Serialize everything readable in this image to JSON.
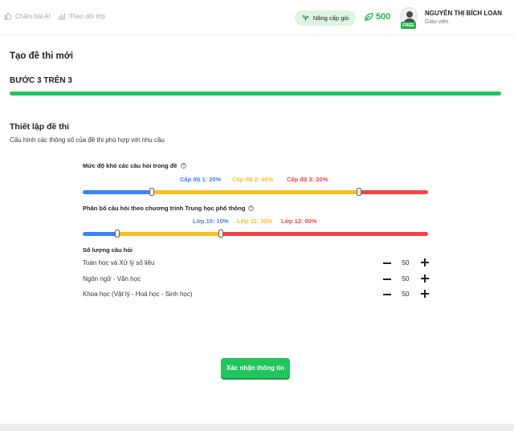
{
  "topbar": {
    "nav": [
      {
        "label": "Chấm bài AI",
        "icon": "thumbs-up-icon"
      },
      {
        "label": "Theo dõi lớp",
        "icon": "bar-chart-icon"
      }
    ],
    "upgrade_label": "Nâng cấp gói",
    "points": "500",
    "user": {
      "name": "NGUYỄN THỊ BÍCH LOAN",
      "role": "Giáo viên",
      "badge": "FREE"
    }
  },
  "page": {
    "title": "Tạo đề thi mới",
    "step": "BƯỚC 3 TRÊN 3",
    "step_progress": 1.0
  },
  "settings": {
    "title": "Thiết lập đề thi",
    "subtitle": "Cấu hình các thông số của đề thi phù hợp với nhu cầu",
    "difficulty": {
      "label": "Mức độ khó các câu hỏi trong đề",
      "levels": [
        {
          "label": "Cấp độ 1: 20%",
          "value": 20,
          "color": "#3b82f6"
        },
        {
          "label": "Cấp độ 2: 60%",
          "value": 60,
          "color": "#fbbf24"
        },
        {
          "label": "Cấp độ 3: 20%",
          "value": 20,
          "color": "#ef4444"
        }
      ]
    },
    "curriculum": {
      "label": "Phân bổ câu hỏi theo chương trình Trung học phổ thông",
      "levels": [
        {
          "label": "Lớp 10: 10%",
          "value": 10,
          "color": "#3b82f6"
        },
        {
          "label": "Lớp 11: 30%",
          "value": 30,
          "color": "#fbbf24"
        },
        {
          "label": "Lớp 12: 60%",
          "value": 60,
          "color": "#ef4444"
        }
      ]
    },
    "quantity": {
      "label": "Số lượng câu hỏi",
      "rows": [
        {
          "name": "Toán học và Xử lý số liệu",
          "value": "50"
        },
        {
          "name": "Ngôn ngữ - Văn học",
          "value": "50"
        },
        {
          "name": "Khoa học (Vật lý - Hoá học - Sinh học)",
          "value": "50"
        }
      ]
    }
  },
  "confirm_label": "Xác nhận thông tin"
}
